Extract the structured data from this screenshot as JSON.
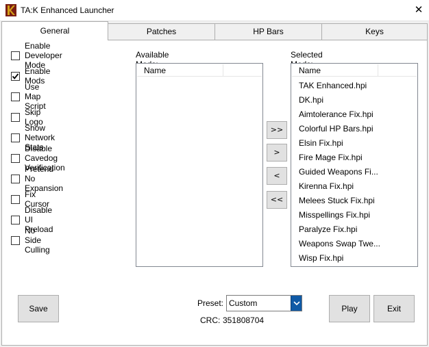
{
  "window": {
    "title": "TA:K Enhanced Launcher",
    "close_glyph": "✕"
  },
  "tabs": [
    {
      "label": "General",
      "active": true
    },
    {
      "label": "Patches",
      "active": false
    },
    {
      "label": "HP Bars",
      "active": false
    },
    {
      "label": "Keys",
      "active": false
    }
  ],
  "options": [
    {
      "label": "Enable Developer Mode",
      "checked": false
    },
    {
      "label": "Enable Mods",
      "checked": true
    },
    {
      "label": "Use Map Script",
      "checked": false
    },
    {
      "label": "Skip Logo",
      "checked": false
    },
    {
      "label": "Show Network Stats",
      "checked": false
    },
    {
      "label": "Disable Cavedog Verification",
      "checked": false
    },
    {
      "label": "Pretend No Expansion",
      "checked": false
    },
    {
      "label": "Fix Cursor",
      "checked": false
    },
    {
      "label": "Disable UI Preload",
      "checked": false
    },
    {
      "label": "No Side Culling",
      "checked": false
    }
  ],
  "available_mods": {
    "label": "Available Mods:",
    "column_header": "Name",
    "items": []
  },
  "selected_mods": {
    "label": "Selected Mods:",
    "column_header": "Name",
    "items": [
      "TAK Enhanced.hpi",
      "DK.hpi",
      "Aimtolerance Fix.hpi",
      "Colorful HP Bars.hpi",
      "Elsin Fix.hpi",
      "Fire Mage Fix.hpi",
      "Guided Weapons Fi...",
      "Kirenna Fix.hpi",
      "Melees Stuck Fix.hpi",
      "Misspellings Fix.hpi",
      "Paralyze Fix.hpi",
      "Weapons Swap Twe...",
      "Wisp Fix.hpi"
    ]
  },
  "transfer_buttons": {
    "add_all": ">>",
    "add": ">",
    "remove": "<",
    "remove_all": "<<"
  },
  "footer": {
    "save_label": "Save",
    "preset_label": "Preset:",
    "preset_value": "Custom",
    "crc_label": "CRC:",
    "crc_value": "351808704",
    "play_label": "Play",
    "exit_label": "Exit"
  },
  "colors": {
    "select_arrow": "#0f5aa6",
    "icon_red": "#c0392b",
    "icon_gold": "#d4a017"
  },
  "icons": {
    "app": "tak-logo-icon",
    "check": "checkmark-icon",
    "dropdown": "chevron-down-icon"
  }
}
